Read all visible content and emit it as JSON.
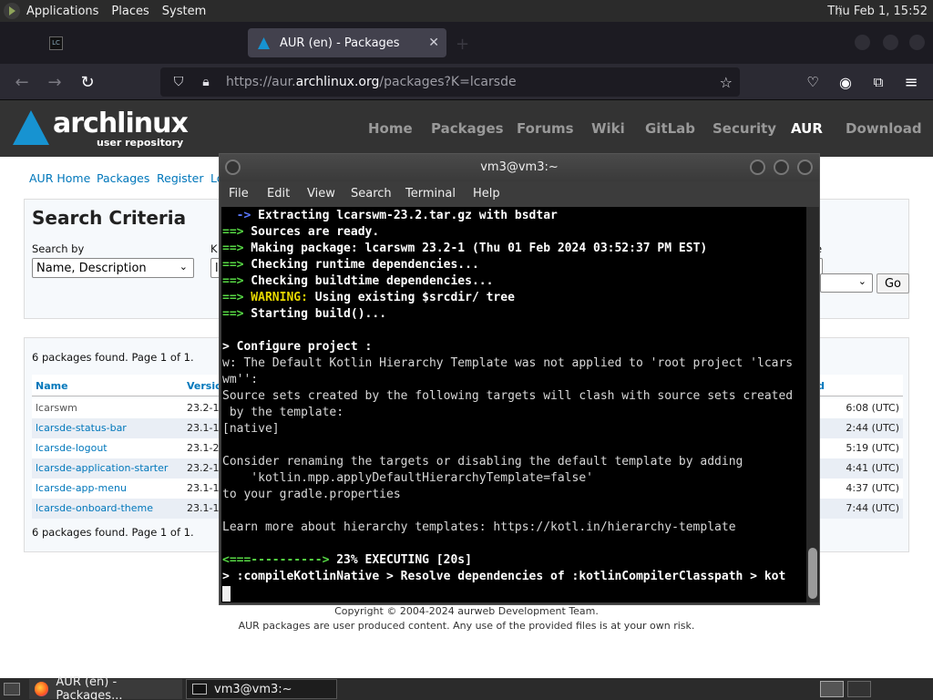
{
  "top_panel": {
    "menus": [
      "Applications",
      "Places",
      "System"
    ],
    "clock": "Thu Feb  1, 15:52"
  },
  "browser": {
    "tabs": [
      {
        "title": "",
        "icon": "terminal-tab-icon",
        "active": false
      },
      {
        "title": "AUR (en) - Packages",
        "icon": "arch-linux-favicon",
        "active": true
      }
    ],
    "url": {
      "prefix": "https://aur.",
      "domain": "archlinux.org",
      "path": "/packages?K=lcarsde"
    }
  },
  "aur": {
    "logo_main": "archlinux",
    "logo_sub": "user repository",
    "nav": [
      "Home",
      "Packages",
      "Forums",
      "Wiki",
      "GitLab",
      "Security",
      "AUR",
      "Download"
    ],
    "nav_current": "AUR",
    "links": [
      "AUR Home",
      "Packages",
      "Register",
      "Lo"
    ],
    "criteria_title": "Search Criteria",
    "search_by_label": "Search by",
    "search_by_value": "Name, Description",
    "keywords_label": "K",
    "keywords_partial": "l",
    "right_label_partial": "e",
    "go_label": "Go",
    "page_count": "6 packages found. Page 1 of 1.",
    "table": {
      "headers": [
        "Name",
        "Version",
        "d"
      ],
      "rows": [
        {
          "name": "lcarswm",
          "version": "23.2-1",
          "date": "6:08 (UTC)"
        },
        {
          "name": "lcarsde-status-bar",
          "version": "23.1-1",
          "date": "2:44 (UTC)"
        },
        {
          "name": "lcarsde-logout",
          "version": "23.1-2",
          "date": "5:19 (UTC)"
        },
        {
          "name": "lcarsde-application-starter",
          "version": "23.2-1",
          "date": "4:41 (UTC)"
        },
        {
          "name": "lcarsde-app-menu",
          "version": "23.1-1",
          "date": "4:37 (UTC)"
        },
        {
          "name": "lcarsde-onboard-theme",
          "version": "23.1-1",
          "date": "7:44 (UTC)"
        }
      ]
    },
    "footer_copyright": "Copyright © 2004-2024 aurweb Development Team.",
    "footer_note": "AUR packages are user produced content. Any use of the provided files is at your own risk."
  },
  "terminal": {
    "title": "vm3@vm3:~",
    "menu": [
      "File",
      "Edit",
      "View",
      "Search",
      "Terminal",
      "Help"
    ],
    "lines": [
      {
        "arrow": "  ->",
        "text": " Extracting lcarswm-23.2.tar.gz with bsdtar",
        "style": "b"
      },
      {
        "arrow": "==>",
        "text": " Sources are ready.",
        "style": "g"
      },
      {
        "arrow": "==>",
        "text": " Making package: lcarswm 23.2-1 (Thu 01 Feb 2024 03:52:37 PM EST)",
        "style": "g"
      },
      {
        "arrow": "==>",
        "text": " Checking runtime dependencies...",
        "style": "g"
      },
      {
        "arrow": "==>",
        "text": " Checking buildtime dependencies...",
        "style": "g"
      },
      {
        "arrow": "==>",
        "warn": " WARNING:",
        "text": " Using existing $srcdir/ tree",
        "style": "g"
      },
      {
        "arrow": "==>",
        "text": " Starting build()...",
        "style": "g"
      },
      {
        "plain": ""
      },
      {
        "bold": "> Configure project :"
      },
      {
        "plain": "w: The Default Kotlin Hierarchy Template was not applied to 'root project 'lcars"
      },
      {
        "plain": "wm'':"
      },
      {
        "plain": "Source sets created by the following targets will clash with source sets created"
      },
      {
        "plain": " by the template:"
      },
      {
        "plain": "[native]"
      },
      {
        "plain": ""
      },
      {
        "plain": "Consider renaming the targets or disabling the default template by adding"
      },
      {
        "plain": "    'kotlin.mpp.applyDefaultHierarchyTemplate=false'"
      },
      {
        "plain": "to your gradle.properties"
      },
      {
        "plain": ""
      },
      {
        "plain": "Learn more about hierarchy templates: https://kotl.in/hierarchy-template"
      },
      {
        "plain": ""
      },
      {
        "progress_bar": "<===---------->",
        "progress_text": " 23% EXECUTING [20s]"
      },
      {
        "bold": "> :compileKotlinNative > Resolve dependencies of :kotlinCompilerClasspath > kot"
      }
    ],
    "progress_percent": 23
  },
  "bottom_panel": {
    "tasks": [
      "AUR (en) - Packages...",
      "vm3@vm3:~"
    ]
  }
}
